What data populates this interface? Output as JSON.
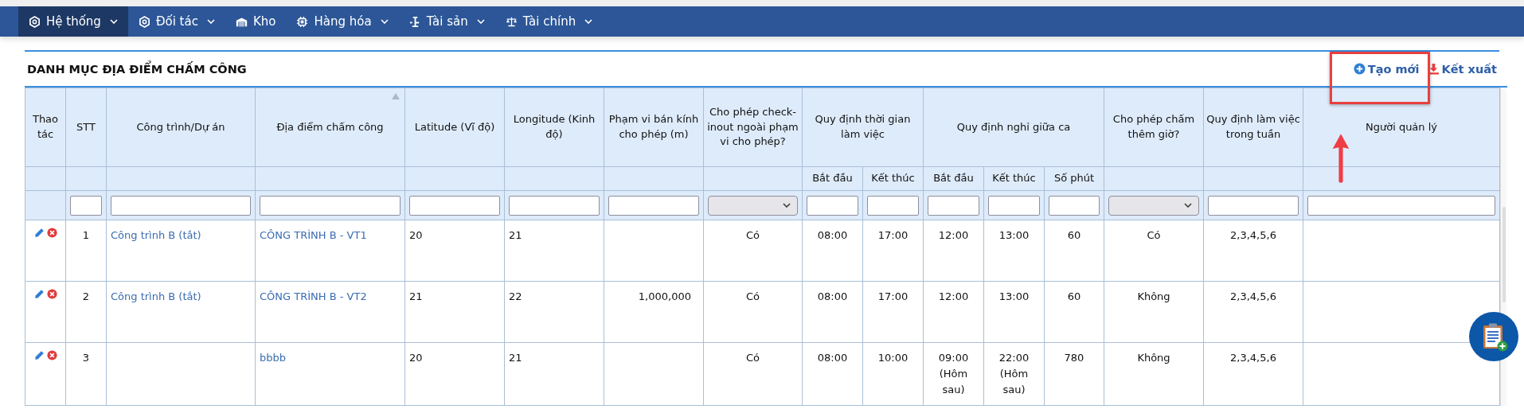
{
  "nav": {
    "items": [
      {
        "label": "Hệ thống",
        "selected": true,
        "dropdown": true
      },
      {
        "label": "Đối tác",
        "selected": false,
        "dropdown": true
      },
      {
        "label": "Kho",
        "selected": false,
        "dropdown": false
      },
      {
        "label": "Hàng hóa",
        "selected": false,
        "dropdown": true
      },
      {
        "label": "Tài sản",
        "selected": false,
        "dropdown": true
      },
      {
        "label": "Tài chính",
        "selected": false,
        "dropdown": true
      }
    ]
  },
  "panel": {
    "title": "DANH MỤC ĐỊA ĐIỂM CHẤM CÔNG",
    "actions": [
      {
        "label": "Tạo mới",
        "kind": "create",
        "highlighted": true
      },
      {
        "label": "Kết xuất",
        "kind": "export",
        "highlighted": false
      }
    ]
  },
  "table": {
    "columns": [
      {
        "label": "Thao tác",
        "kind": "actions",
        "sorted": false
      },
      {
        "label": "STT",
        "kind": "center",
        "sorted": false
      },
      {
        "label": "Công trình/Dự án",
        "kind": "link",
        "sorted": false
      },
      {
        "label": "Địa điểm chấm công",
        "kind": "link",
        "sorted": true
      },
      {
        "label": "Latitude (Vĩ độ)",
        "kind": "left",
        "sorted": false
      },
      {
        "label": "Longitude (Kinh độ)",
        "kind": "left",
        "sorted": false
      },
      {
        "label": "Phạm vi bán kính cho phép (m)",
        "kind": "right",
        "sorted": false
      },
      {
        "label": "Cho phép check-inout ngoài phạm vi cho phép?",
        "kind": "center",
        "sorted": false
      },
      {
        "label": "Quy định thời gian làm việc",
        "colspan": 2,
        "children": [
          {
            "label": "Bắt đầu",
            "kind": "center"
          },
          {
            "label": "Kết thúc",
            "kind": "center"
          }
        ]
      },
      {
        "label": "Quy định nghỉ giữa ca",
        "colspan": 3,
        "children": [
          {
            "label": "Bắt đầu",
            "kind": "center"
          },
          {
            "label": "Kết thúc",
            "kind": "center"
          },
          {
            "label": "Số phút",
            "kind": "center"
          }
        ]
      },
      {
        "label": "Cho phép chấm thêm giờ?",
        "kind": "center",
        "sorted": false
      },
      {
        "label": "Quy định làm việc trong tuần",
        "kind": "center",
        "sorted": false
      },
      {
        "label": "Người quản lý",
        "kind": "left",
        "sorted": false
      }
    ],
    "filters": [
      {
        "kind": "none"
      },
      {
        "kind": "text"
      },
      {
        "kind": "text"
      },
      {
        "kind": "text"
      },
      {
        "kind": "text"
      },
      {
        "kind": "text"
      },
      {
        "kind": "text"
      },
      {
        "kind": "select"
      },
      {
        "kind": "text"
      },
      {
        "kind": "text"
      },
      {
        "kind": "text"
      },
      {
        "kind": "text"
      },
      {
        "kind": "text"
      },
      {
        "kind": "select"
      },
      {
        "kind": "text"
      },
      {
        "kind": "text"
      }
    ],
    "rows": [
      {
        "cells": [
          null,
          "1",
          "Công trình B (tắt)",
          "CÔNG TRÌNH B - VT1",
          "20",
          "21",
          null,
          "Có",
          "08:00",
          "17:00",
          "12:00",
          "13:00",
          "60",
          "Có",
          "2,3,4,5,6",
          null
        ]
      },
      {
        "cells": [
          null,
          "2",
          "Công trình B (tắt)",
          "CÔNG TRÌNH B - VT2",
          "21",
          "22",
          "1,000,000",
          "Có",
          "08:00",
          "17:00",
          "12:00",
          "13:00",
          "60",
          "Không",
          "2,3,4,5,6",
          null
        ]
      },
      {
        "cells": [
          null,
          "3",
          null,
          "bbbb",
          "20",
          "21",
          null,
          "Có",
          "08:00",
          "10:00",
          "09:00 (Hôm sau)",
          "22:00 (Hôm sau)",
          "780",
          "Không",
          "2,3,4,5,6",
          null
        ]
      }
    ]
  }
}
